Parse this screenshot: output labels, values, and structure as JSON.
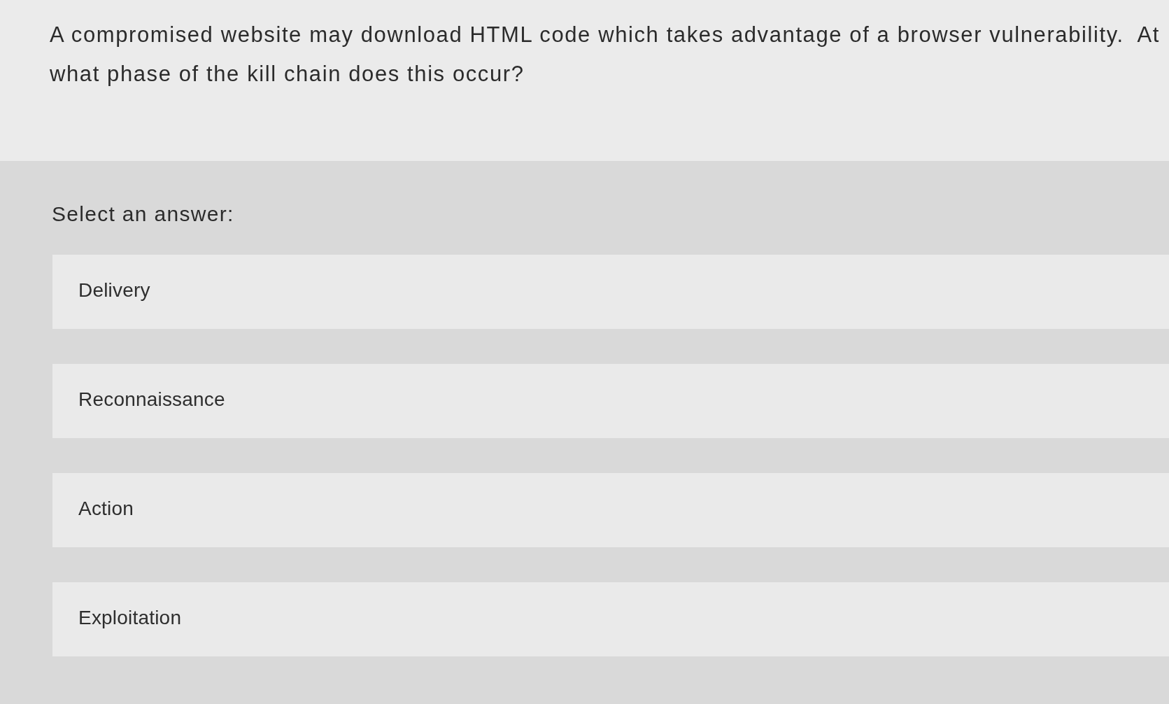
{
  "question": {
    "text": "A compromised website may download HTML code which takes advantage of a browser vulnerability.  At what phase of the kill chain does this occur?"
  },
  "answers": {
    "prompt": "Select an answer:",
    "options": [
      {
        "label": "Delivery",
        "selected": false
      },
      {
        "label": "Reconnaissance",
        "selected": false
      },
      {
        "label": "Action",
        "selected": false
      },
      {
        "label": "Exploitation",
        "selected": false
      }
    ]
  }
}
